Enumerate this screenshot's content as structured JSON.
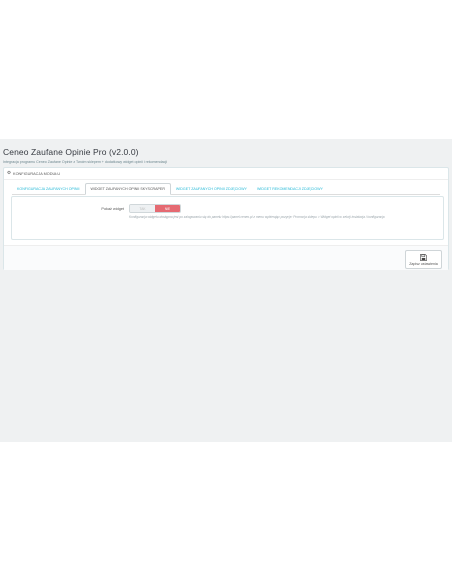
{
  "header": {
    "title": "Ceneo Zaufane Opinie Pro (v2.0.0)",
    "subtitle": "Integracja programu Ceneo Zaufane Opinie z Twoim sklepem + dodatkowy widget opinii i rekomendacji"
  },
  "panel": {
    "heading": "KONFIGURACJA MODUŁU",
    "heading_icon": "gear-icon"
  },
  "tabs": [
    {
      "label": "KONFIGURACJA ZAUFANYCH OPINII",
      "active": false
    },
    {
      "label": "WIDGET ZAUFANYCH OPINII SKYSCRAPER",
      "active": true
    },
    {
      "label": "WIDGET ZAUFANYCH OPINII ZDJĘCIOWY",
      "active": false
    },
    {
      "label": "WIDGET REKOMENDACJI ZDJĘCIOWY",
      "active": false
    }
  ],
  "form": {
    "show_widget_label": "Pokaż widget",
    "switch": {
      "yes": "TAK",
      "no": "NIE",
      "selected": "NIE"
    },
    "help": "Konfiguracja widgetu dostępna jest po zalogowaniu się do panelu https://panel.ceneo.pl z menu wybierając pozycje: Promocja sklepu > Widget opinii w sekcji instalacja i konfiguracja"
  },
  "footer": {
    "save_label": "Zapisz ustawienia",
    "save_icon": "save-icon"
  },
  "colors": {
    "accent": "#25b9d7",
    "switch_no": "#e56a72",
    "background": "#eff1f2"
  }
}
